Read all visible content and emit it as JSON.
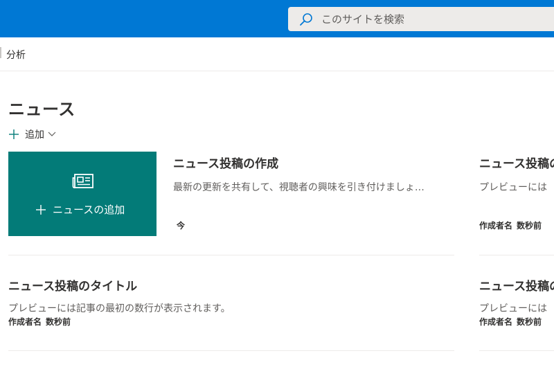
{
  "header": {
    "search_placeholder": "このサイトを検索"
  },
  "nav": {
    "items": [
      {
        "label": "分析"
      }
    ]
  },
  "news": {
    "heading": "ニュース",
    "add_label": "追加",
    "tile_label": "ニュースの追加",
    "first_card": {
      "title": "ニュース投稿の作成",
      "description": "最新の更新を共有して、視聴者の興味を引き付けましょ…",
      "time": "今"
    },
    "right_card_1": {
      "title": "ニュース投稿の",
      "description": "プレビューには",
      "author": "作成者名",
      "time": "数秒前"
    },
    "second_card": {
      "title": "ニュース投稿のタイトル",
      "description": "プレビューには記事の最初の数行が表示されます。",
      "author": "作成者名",
      "time": "数秒前"
    },
    "right_card_2": {
      "title": "ニュース投稿の",
      "description": "プレビューには",
      "author": "作成者名",
      "time": "数秒前"
    }
  },
  "colors": {
    "suite_bar": "#0078d4",
    "tile_bg": "#037b78"
  },
  "icons": [
    "search-icon",
    "plus-icon",
    "chevron-down-icon",
    "news-icon"
  ]
}
